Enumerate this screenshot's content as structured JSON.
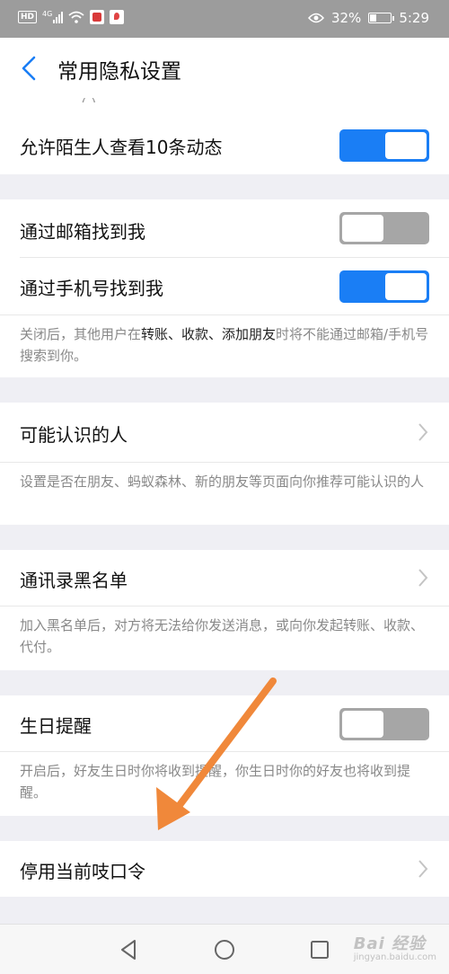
{
  "status_bar": {
    "network_badge": "HD",
    "signal_badge": "4G",
    "battery_percent": "32%",
    "battery_level": 0.32,
    "time": "5:29"
  },
  "header": {
    "title": "常用隐私设置"
  },
  "settings": {
    "stranger_posts": {
      "label": "允许陌生人查看10条动态",
      "enabled": true
    },
    "find_by_email": {
      "label": "通过邮箱找到我",
      "enabled": false
    },
    "find_by_phone": {
      "label": "通过手机号找到我",
      "enabled": true
    },
    "find_hint": {
      "prefix": "关闭后，其他用户在",
      "highlight": "转账、收款、添加朋友",
      "suffix": "时将不能通过邮箱/手机号搜索到你。"
    },
    "people_you_may_know": {
      "label": "可能认识的人",
      "hint": "设置是否在朋友、蚂蚁森林、新的朋友等页面向你推荐可能认识的人"
    },
    "contacts_blacklist": {
      "label": "通讯录黑名单",
      "hint": "加入黑名单后，对方将无法给你发送消息，或向你发起转账、收款、代付。"
    },
    "birthday_reminder": {
      "label": "生日提醒",
      "enabled": false,
      "hint": "开启后，好友生日时你将收到提醒，你生日时你的好友也将收到提醒。"
    },
    "disable_passphrase": {
      "label": "停用当前吱口令"
    }
  },
  "watermark": {
    "brand": "Bai 经验",
    "url": "jingyan.baidu.com"
  },
  "colors": {
    "accent": "#1a7ef5",
    "toggle_off": "#a6a6a6",
    "annotation_arrow": "#f0883a"
  }
}
